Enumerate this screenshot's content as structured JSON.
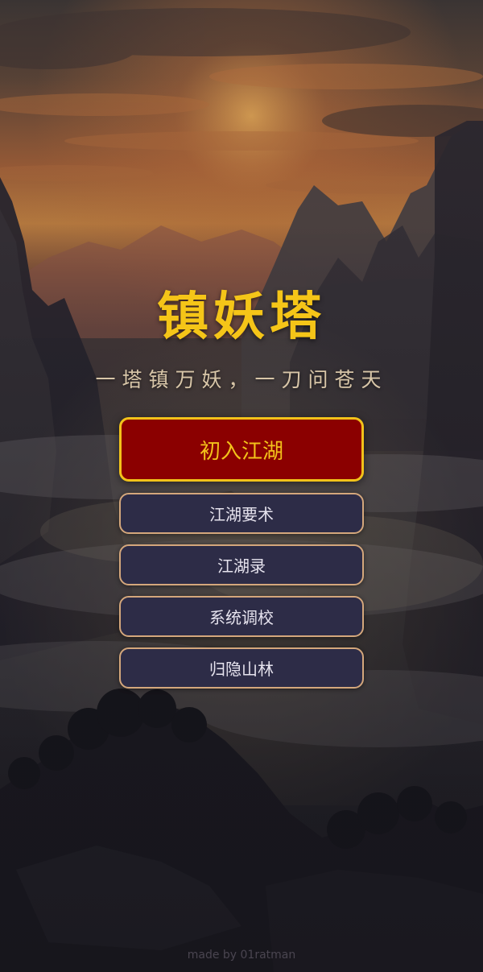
{
  "game": {
    "title": "镇妖塔",
    "subtitle": "一塔镇万妖，一刀问苍天",
    "credit": "made by 01ratman"
  },
  "menu": {
    "items": [
      {
        "label": "初入江湖",
        "primary": true
      },
      {
        "label": "江湖要术",
        "primary": false
      },
      {
        "label": "江湖录",
        "primary": false
      },
      {
        "label": "系统调校",
        "primary": false
      },
      {
        "label": "归隐山林",
        "primary": false
      }
    ]
  },
  "colors": {
    "title": "#f5c518",
    "subtitle": "#d8c6a8",
    "primary_bg": "#8b0000",
    "primary_border": "#f2c21a",
    "primary_text": "#f3c21a",
    "secondary_bg": "#2d2c47",
    "secondary_border": "#d4a77c",
    "secondary_text": "#e6e3ee",
    "credit_text": "#4a4550"
  },
  "background": {
    "scene": "ink-wash mountain landscape at sunset with clouds"
  }
}
